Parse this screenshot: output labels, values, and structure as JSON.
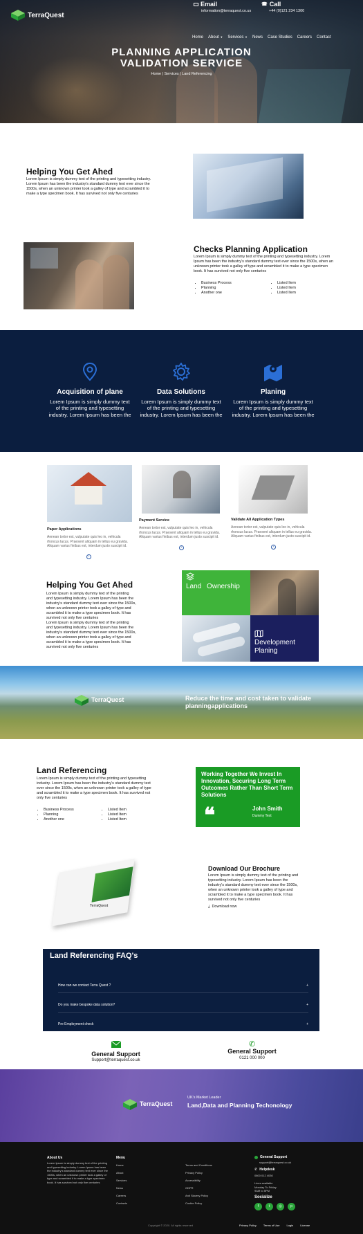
{
  "brand": {
    "name": "TerraQuest",
    "green": "#2aa53a",
    "navy": "#0b1e3f",
    "blue": "#2b6fd6"
  },
  "header": {
    "email_label": "Email",
    "email_value": "information@terraquest.co.us",
    "call_label": "Call",
    "call_value": "+44 (0)121 234 1300",
    "nav": [
      "Home",
      "About",
      "Services",
      "News",
      "Case Studies",
      "Careers",
      "Contact"
    ],
    "title_line1": "PLANNING APPLICATION",
    "title_line2": "VALIDATION SERVICE",
    "breadcrumb": "Home | Services | Land Referencing"
  },
  "intro": {
    "title": "Helping You Get Ahed",
    "text": "Lorem Ipsum is simply dummy text of the printing and typesetting industry. Lorem Ipsum has been the industry's standard dummy text ever since the 1500s, when an unknown printer took a galley of type and scrambled it to make a type specimen book. It has survived not only five centuries"
  },
  "checks": {
    "title": "Checks Planning Application",
    "text": "Lorem Ipsum is simply dummy text of the printing and typesetting industry. Lorem Ipsum has been the industry's standard dummy text ever since the 1500s, when an unknown printer took a galley of type and scrambled it to make a type specimen book. It has survived not only five centuries",
    "list_a": [
      "Business Process",
      "Planning",
      "Another one"
    ],
    "list_b": [
      "Listed Item",
      "Listed Item",
      "Listed Item"
    ]
  },
  "services": [
    {
      "icon": "location-pin-icon",
      "title": "Acquisition of plane",
      "text": "Lorem Ipsum is simply dummy text of the printing and typesetting industry. Lorem Ipsum has been the"
    },
    {
      "icon": "gear-icon",
      "title": "Data Solutions",
      "text": "Lorem Ipsum is simply dummy text of the printing and typesetting industry. Lorem Ipsum has been the"
    },
    {
      "icon": "map-icon",
      "title": "Planing",
      "text": "Lorem Ipsum is simply dummy text of the printing and typesetting industry. Lorem Ipsum has been the"
    }
  ],
  "cards": [
    {
      "title": "Paper Applications",
      "text": "Aenean tortor est, vulputate quis leo in, vehicula rhoncus lacus. Praesent aliquam in tellus eu gravida. Aliquam varius finibus est, interdum justo suscipit id."
    },
    {
      "title": "Payment Service",
      "text": "Aenean tortor est, vulputate quis leo in, vehicula rhoncus lacus. Praesent aliquam in tellus eu gravida. Aliquam varius finibus est, interdum justo suscipit id."
    },
    {
      "title": "Validate All Application Types",
      "text": "Aenean tortor est, vulputate quis leo in, vehicula rhoncus lacus. Praesent aliquam in tellus eu gravida. Aliquam varius finibus est, interdum justo suscipit id."
    }
  ],
  "ahead2": {
    "title": "Helping You Get Ahed",
    "text1": "Lorem Ipsum is simply dummy text of the printing and typesetting industry. Lorem Ipsum has been the industry's standard dummy text ever since the 1500s, when an unknown printer took a galley of type and scrambled it to make a type specimen book. It has survived not only five centuries",
    "text2": "Lorem Ipsum is simply dummy text of the printing and typesetting industry. Lorem Ipsum has been the industry's standard dummy text ever since the 1500s, when an unknown printer took a galley of type and scrambled it to make a type specimen book. It has survived not only five centuries",
    "tile_land": "Land",
    "tile_ownership": "Ownership",
    "tile_dev1": "Development",
    "tile_dev2": "Planing"
  },
  "banner": {
    "logo": "TerraQuest",
    "line1": "Reduce the time and cost taken to validate",
    "line2": "planningapplications"
  },
  "land_ref": {
    "title": "Land Referencing",
    "text": "Lorem Ipsum is simply dummy text of the printing and typesetting industry. Lorem Ipsum has been the industry's standard dummy text ever since the 1500s, when an unknown printer took a galley of type and scrambled it to make a type specimen book. It has survived not only five centuries",
    "list_a": [
      "Business Process",
      "Planning",
      "Another one"
    ],
    "list_b": [
      "Listed Item",
      "Listed Item",
      "Listed Item"
    ]
  },
  "quote": {
    "text": "Working Together We Invest In Innovation, Securing Long Term Outcomes Rather Than Short Term Solutions",
    "name": "John Smith",
    "role": "Dummy Text"
  },
  "brochure": {
    "title": "Download Our Brochure",
    "text": "Lorem Ipsum is simply dummy text of the printing and typesetting industry. Lorem Ipsum has been the industry's standard dummy text ever since the 1500s, when an unknown printer took a galley of type and scrambled it to make a type specimen book. It has survived not only five centuries",
    "link": "Download now",
    "cover_brand": "TerraQuest"
  },
  "faq": {
    "title": "Land Referencing FAQ's",
    "items": [
      "How can we contact Terra Quest ?",
      "Do you make bespoke data solution?",
      "Pre Employment check"
    ]
  },
  "support": [
    {
      "title": "General Support",
      "value": "Support@terraquest.co.uk"
    },
    {
      "title": "General Support",
      "value": "0121 000 000"
    }
  ],
  "about_banner": {
    "logo": "TerraQuest",
    "small": "UK's Market Leader",
    "big": "Land,Data and Planning Techonology"
  },
  "footer": {
    "about_title": "About Us",
    "about_text": "Lorem Ipsum is simply dummy text of the printing and typesetting industry. Lorem Ipsum has been the industry's standard dummy text ever since the 1500s, when an unknown printer took a galley of type and scrambled it to make a type specimen book. It has survived not only five centuries",
    "menu_title": "Menu",
    "menu": [
      "Home",
      "About",
      "Services",
      "News",
      "Careers",
      "Contacts"
    ],
    "links": [
      "Terms and Conditions",
      "Privacy Policy",
      "Accessibility",
      "GDPR",
      "Anti Slavery Policy",
      "Cookie Policy"
    ],
    "support_title": "General Support",
    "support_email": "support@terraquest.co.uk",
    "helpdesk_title": "Helpdesk",
    "helpdesk_phone": "0800 012 4030",
    "lines_title": "Lines available",
    "lines_days": "Monday To Friday",
    "lines_hours": "9AM to 5PM",
    "socialize": "Socialize",
    "social_icons": [
      "facebook-icon",
      "twitter-icon",
      "instagram-icon",
      "pinterest-icon"
    ],
    "copyright": "Copyright © 2020. All rights reserved",
    "bottom_links": [
      "Privacy Policy",
      "Terms of Use",
      "Login",
      "License"
    ]
  }
}
